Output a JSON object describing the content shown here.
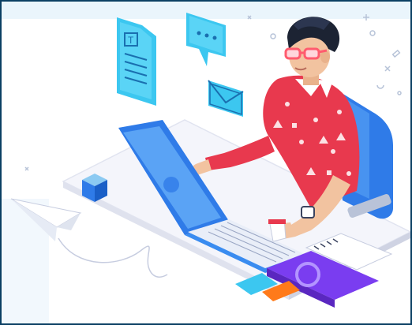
{
  "scene": {
    "subject": "developer-working-on-laptop",
    "icons": [
      "document-icon",
      "chat-bubble-icon",
      "envelope-icon",
      "cube-icon",
      "paper-plane-icon",
      "notebook-icon",
      "coffee-mug-icon",
      "sticky-notes-icon",
      "keyboard-icon"
    ],
    "colors": {
      "frame": "#0b3f63",
      "accent_blue": "#2f7be8",
      "light_blue": "#8ccaf2",
      "cyan": "#3cc7f0",
      "shirt_red": "#e8394e",
      "skin": "#f2c3a0",
      "hair": "#1c2333",
      "glasses": "#ff5b6e",
      "desk_top": "#f4f5fb",
      "book_purple": "#7a3df0",
      "note_orange": "#ff7a1a"
    }
  }
}
